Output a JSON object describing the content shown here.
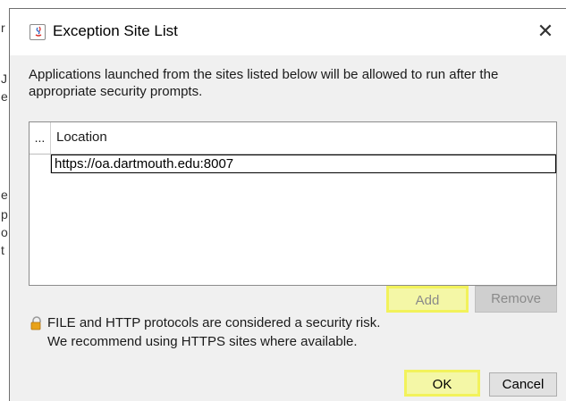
{
  "dialog": {
    "title": "Exception Site List",
    "close_glyph": "✕",
    "description": "Applications launched from the sites listed below will be allowed to run after the appropriate security prompts.",
    "table": {
      "columns": [
        "...",
        "Location"
      ],
      "rows": [
        {
          "location": "https://oa.dartmouth.edu:8007"
        }
      ]
    },
    "buttons": {
      "add": "Add",
      "remove": "Remove",
      "ok": "OK",
      "cancel": "Cancel"
    },
    "warning": {
      "line1": "FILE and HTTP protocols are considered a security risk.",
      "line2": "We recommend using HTTPS sites where available."
    },
    "highlight_color": "#f2f25b"
  },
  "background": {
    "edge_chars": [
      "r",
      "J",
      "e",
      "e",
      "p",
      "o",
      "t"
    ]
  }
}
